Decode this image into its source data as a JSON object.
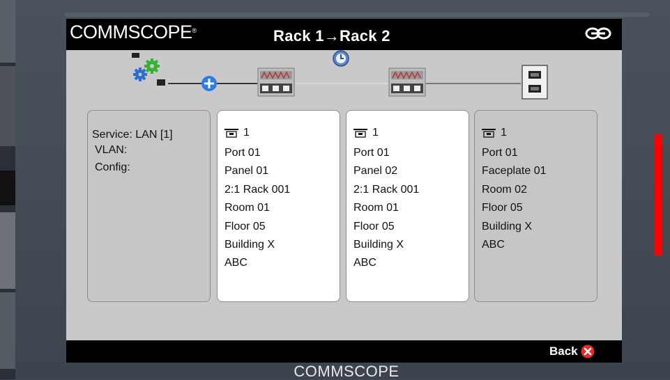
{
  "brand": {
    "name": "COMMSCOPE",
    "mark": "®"
  },
  "title": "Rack 1→Rack 2",
  "bottom_logo": "COMMSCOPE",
  "back_label": "Back",
  "icons": {
    "link": "link-icon",
    "close": "close-icon",
    "clock": "clock-icon",
    "add": "add-icon",
    "settings": "gears-icon",
    "panel": "patch-panel-icon",
    "faceplate": "faceplate-icon",
    "port": "port-icon"
  },
  "colors": {
    "accent_blue": "#2a7de1",
    "close_red": "#e8282a",
    "indicator_red": "#ff0000"
  },
  "info": {
    "service": "Service: LAN [1]",
    "vlan": "VLAN:",
    "config": "Config:"
  },
  "cards": [
    {
      "port_no": "1",
      "lines": [
        "Port 01",
        "Panel 01",
        "2:1 Rack 001",
        "Room 01",
        "Floor 05",
        "Building X",
        "ABC"
      ]
    },
    {
      "port_no": "1",
      "lines": [
        "Port 01",
        "Panel 02",
        "2:1 Rack 001",
        "Room 01",
        "Floor 05",
        "Building X",
        "ABC"
      ]
    },
    {
      "port_no": "1",
      "lines": [
        "Port 01",
        "Faceplate 01",
        "Room 02",
        "Floor 05",
        "Building X",
        "ABC"
      ]
    }
  ]
}
